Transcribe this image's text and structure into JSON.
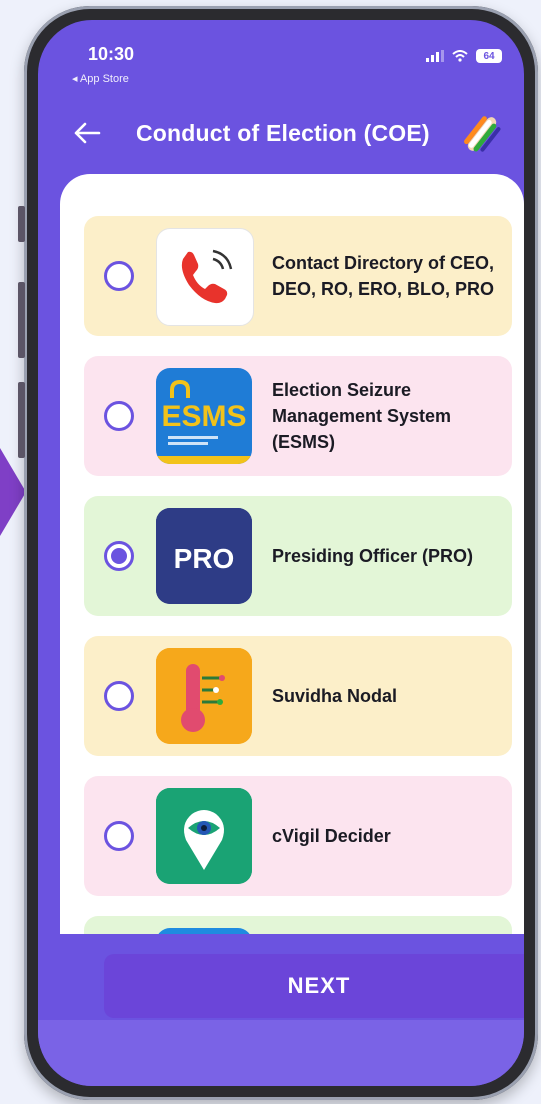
{
  "status_bar": {
    "time": "10:30",
    "back_app": "◂ App Store",
    "battery": "64"
  },
  "header": {
    "title": "Conduct of Election (COE)"
  },
  "options": [
    {
      "label": "Contact Directory of CEO, DEO, RO, ERO, BLO, PRO",
      "selected": false,
      "background": "#fcefc9",
      "icon": "phone-call-icon"
    },
    {
      "label": "Election Seizure Management System (ESMS)",
      "selected": false,
      "background": "#fce4ef",
      "icon": "esms-logo-icon",
      "icon_text": "ESMS"
    },
    {
      "label": "Presiding Officer (PRO)",
      "selected": true,
      "background": "#e3f6d7",
      "icon": "pro-logo-icon",
      "icon_text": "PRO"
    },
    {
      "label": "Suvidha Nodal",
      "selected": false,
      "background": "#fcefc9",
      "icon": "suvidha-thermometer-icon"
    },
    {
      "label": "cVigil Decider",
      "selected": false,
      "background": "#fce4ef",
      "icon": "cvigil-eye-pin-icon"
    }
  ],
  "next_button": {
    "label": "NEXT"
  },
  "colors": {
    "accent": "#6b53e0",
    "button": "#6b45d9",
    "page_bg": "#eef1fb"
  }
}
